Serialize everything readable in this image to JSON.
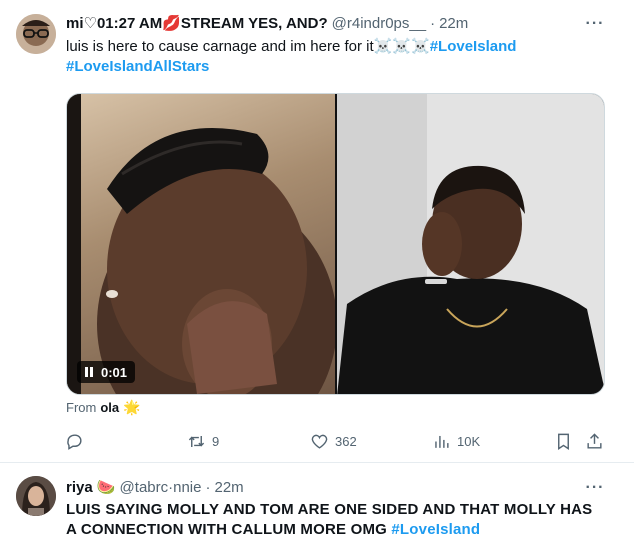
{
  "tweet1": {
    "display_name": "mi♡01:27 AM💋STREAM YES, AND?",
    "handle": "@r4indr0ps__",
    "time": "22m",
    "text_plain": "luis is here to cause carnage and im here for it☠️☠️☠️",
    "hashtag1": "#LoveIsland",
    "hashtag2": "#LoveIslandAllStars",
    "video_time": "0:01",
    "from_label": "From",
    "from_name": "ola",
    "from_emoji": "🌟",
    "replies": "",
    "retweets": "9",
    "likes": "362",
    "views": "10K"
  },
  "tweet2": {
    "display_name": "riya 🍉",
    "handle": "@tabrc·nnie",
    "time": "22m",
    "text": "LUIS SAYING MOLLY AND TOM ARE ONE SIDED AND THAT MOLLY HAS A CONNECTION WITH CALLUM MORE OMG ",
    "hashtag": "#LoveIsland"
  },
  "icons": {
    "more": "more-icon",
    "reply": "reply-icon",
    "retweet": "retweet-icon",
    "like": "heart-icon",
    "views": "views-icon",
    "bookmark": "bookmark-icon",
    "share": "share-icon",
    "pause": "pause-icon"
  },
  "colors": {
    "accent": "#1d9bf0",
    "text": "#0f1419",
    "muted": "#536471"
  }
}
